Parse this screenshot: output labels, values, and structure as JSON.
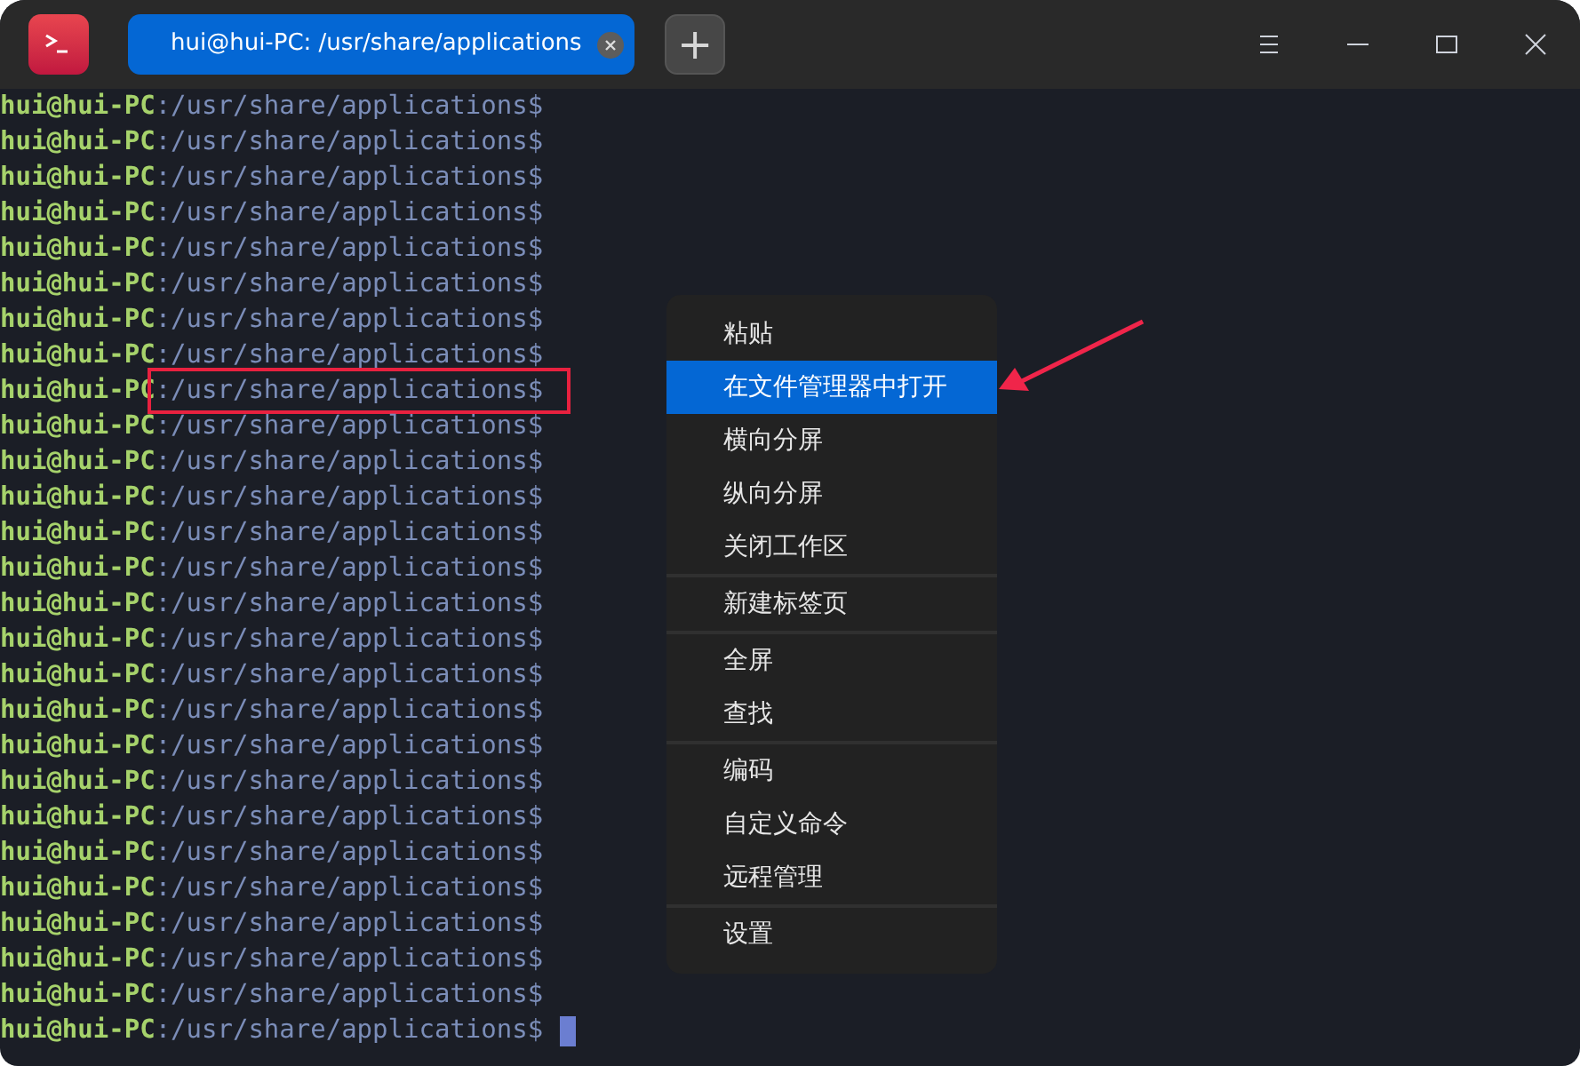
{
  "window": {
    "tabs": [
      {
        "label": "hui@hui-PC: /usr/share/applications",
        "selected": true
      }
    ],
    "new_tab": "+"
  },
  "terminal": {
    "lines": [
      {
        "user": "hui@hui-PC",
        "path": ":/usr/share/applications$",
        "highlighted": false,
        "cursor": false
      },
      {
        "user": "hui@hui-PC",
        "path": ":/usr/share/applications$",
        "highlighted": false,
        "cursor": false
      },
      {
        "user": "hui@hui-PC",
        "path": ":/usr/share/applications$",
        "highlighted": false,
        "cursor": false
      },
      {
        "user": "hui@hui-PC",
        "path": ":/usr/share/applications$",
        "highlighted": false,
        "cursor": false
      },
      {
        "user": "hui@hui-PC",
        "path": ":/usr/share/applications$",
        "highlighted": false,
        "cursor": false
      },
      {
        "user": "hui@hui-PC",
        "path": ":/usr/share/applications$",
        "highlighted": false,
        "cursor": false
      },
      {
        "user": "hui@hui-PC",
        "path": ":/usr/share/applications$",
        "highlighted": false,
        "cursor": false
      },
      {
        "user": "hui@hui-PC",
        "path": ":/usr/share/applications$",
        "highlighted": false,
        "cursor": false
      },
      {
        "user": "hui@hui-PC",
        "path": ":/usr/share/applications$",
        "highlighted": true,
        "cursor": false
      },
      {
        "user": "hui@hui-PC",
        "path": ":/usr/share/applications$",
        "highlighted": false,
        "cursor": false
      },
      {
        "user": "hui@hui-PC",
        "path": ":/usr/share/applications$",
        "highlighted": false,
        "cursor": false
      },
      {
        "user": "hui@hui-PC",
        "path": ":/usr/share/applications$",
        "highlighted": false,
        "cursor": false
      },
      {
        "user": "hui@hui-PC",
        "path": ":/usr/share/applications$",
        "highlighted": false,
        "cursor": false
      },
      {
        "user": "hui@hui-PC",
        "path": ":/usr/share/applications$",
        "highlighted": false,
        "cursor": false
      },
      {
        "user": "hui@hui-PC",
        "path": ":/usr/share/applications$",
        "highlighted": false,
        "cursor": false
      },
      {
        "user": "hui@hui-PC",
        "path": ":/usr/share/applications$",
        "highlighted": false,
        "cursor": false
      },
      {
        "user": "hui@hui-PC",
        "path": ":/usr/share/applications$",
        "highlighted": false,
        "cursor": false
      },
      {
        "user": "hui@hui-PC",
        "path": ":/usr/share/applications$",
        "highlighted": false,
        "cursor": false
      },
      {
        "user": "hui@hui-PC",
        "path": ":/usr/share/applications$",
        "highlighted": false,
        "cursor": false
      },
      {
        "user": "hui@hui-PC",
        "path": ":/usr/share/applications$",
        "highlighted": false,
        "cursor": false
      },
      {
        "user": "hui@hui-PC",
        "path": ":/usr/share/applications$",
        "highlighted": false,
        "cursor": false
      },
      {
        "user": "hui@hui-PC",
        "path": ":/usr/share/applications$",
        "highlighted": false,
        "cursor": false
      },
      {
        "user": "hui@hui-PC",
        "path": ":/usr/share/applications$",
        "highlighted": false,
        "cursor": false
      },
      {
        "user": "hui@hui-PC",
        "path": ":/usr/share/applications$",
        "highlighted": false,
        "cursor": false
      },
      {
        "user": "hui@hui-PC",
        "path": ":/usr/share/applications$",
        "highlighted": false,
        "cursor": false
      },
      {
        "user": "hui@hui-PC",
        "path": ":/usr/share/applications$",
        "highlighted": false,
        "cursor": false
      },
      {
        "user": "hui@hui-PC",
        "path": ":/usr/share/applications$",
        "highlighted": false,
        "cursor": true
      }
    ]
  },
  "context_menu": {
    "groups": [
      [
        {
          "label": "粘贴",
          "selected": false
        },
        {
          "label": "在文件管理器中打开",
          "selected": true
        },
        {
          "label": "横向分屏",
          "selected": false
        },
        {
          "label": "纵向分屏",
          "selected": false
        },
        {
          "label": "关闭工作区",
          "selected": false
        }
      ],
      [
        {
          "label": "新建标签页",
          "selected": false
        }
      ],
      [
        {
          "label": "全屏",
          "selected": false
        },
        {
          "label": "查找",
          "selected": false
        }
      ],
      [
        {
          "label": "编码",
          "selected": false
        },
        {
          "label": "自定义命令",
          "selected": false
        },
        {
          "label": "远程管理",
          "selected": false
        }
      ],
      [
        {
          "label": "设置",
          "selected": false
        }
      ]
    ]
  }
}
